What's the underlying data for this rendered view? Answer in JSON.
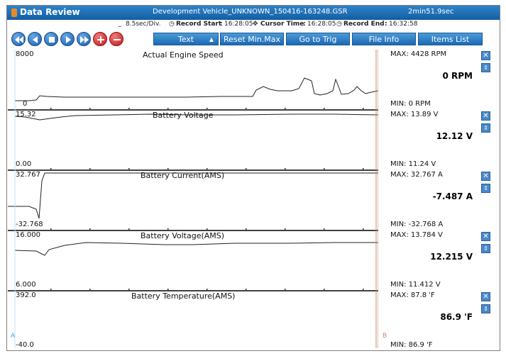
{
  "window": {
    "app_title": "Data Review",
    "file_title": "Development Vehicle_UNKNOWN_150416-163248.GSR",
    "duration": "2min51.9sec"
  },
  "info": {
    "div": "8.5sec/Div.",
    "record_start_label": "Record Start",
    "record_start": "16:28:05",
    "cursor_time_label": "Cursor Time",
    "cursor_time": "16:28:05",
    "record_end_label": "Record End",
    "record_end": "16:32:58"
  },
  "toolbar": {
    "text_label": "Text",
    "reset_label": "Reset Min.Max",
    "goto_trig_label": "Go to Trig",
    "file_info_label": "File Info",
    "items_list_label": "Items List"
  },
  "cursor_labels": {
    "a": "A",
    "b": "B"
  },
  "panels": [
    {
      "title": "Actual Engine Speed",
      "ymax": "8000",
      "ymin": "0",
      "max": "MAX:  4428 RPM",
      "value": "0 RPM",
      "min": "MIN:    0 RPM"
    },
    {
      "title": "Battery Voltage",
      "ymax": "15.32",
      "ymin": "0.00",
      "max": "MAX: 13.89 V",
      "value": "12.12 V",
      "min": "MIN: 11.24 V"
    },
    {
      "title": "Battery Current(AMS)",
      "ymax": "32.767",
      "ymin": "-32.768",
      "max": "MAX: 32.767 A",
      "value": "-7.487 A",
      "min": "MIN: -32.768 A"
    },
    {
      "title": "Battery Voltage(AMS)",
      "ymax": "16.000",
      "ymin": "6.000",
      "max": "MAX: 13.784 V",
      "value": "12.215 V",
      "min": "MIN: 11.412 V"
    },
    {
      "title": "Battery Temperature(AMS)",
      "ymax": "392.0",
      "ymin": "-40.0",
      "max": "MAX:  87.8 'F",
      "value": "86.9 'F",
      "min": "MIN:  86.9 'F"
    }
  ],
  "colors": {
    "accent": "#1f6fba",
    "cursor": "#c98a6a"
  }
}
